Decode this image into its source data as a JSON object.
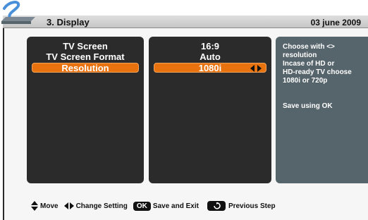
{
  "header": {
    "title": "3. Display",
    "date": "03 june 2009"
  },
  "settings": {
    "items": [
      {
        "label": "TV Screen",
        "value": "16:9"
      },
      {
        "label": "TV Screen Format",
        "value": "Auto"
      },
      {
        "label": "Resolution",
        "value": "1080i",
        "selected": true
      }
    ]
  },
  "help": {
    "lines": [
      "Choose with <>",
      "resolution",
      "Incase of HD or",
      "HD-ready TV choose",
      "1080i or 720p"
    ],
    "save": "Save using OK"
  },
  "footer": {
    "move": "Move",
    "change": "Change Setting",
    "ok_key": "OK",
    "save_exit": "Save and Exit",
    "previous": "Previous Step"
  },
  "icons": {
    "logo": "swoosh-logo-icon",
    "move": "up-down-arrows-icon",
    "change": "left-right-arrows-icon",
    "back": "back-arrow-icon"
  },
  "colors": {
    "accent": "#e8720e",
    "panel": "#2b2b2b",
    "help_panel": "#56646b"
  }
}
